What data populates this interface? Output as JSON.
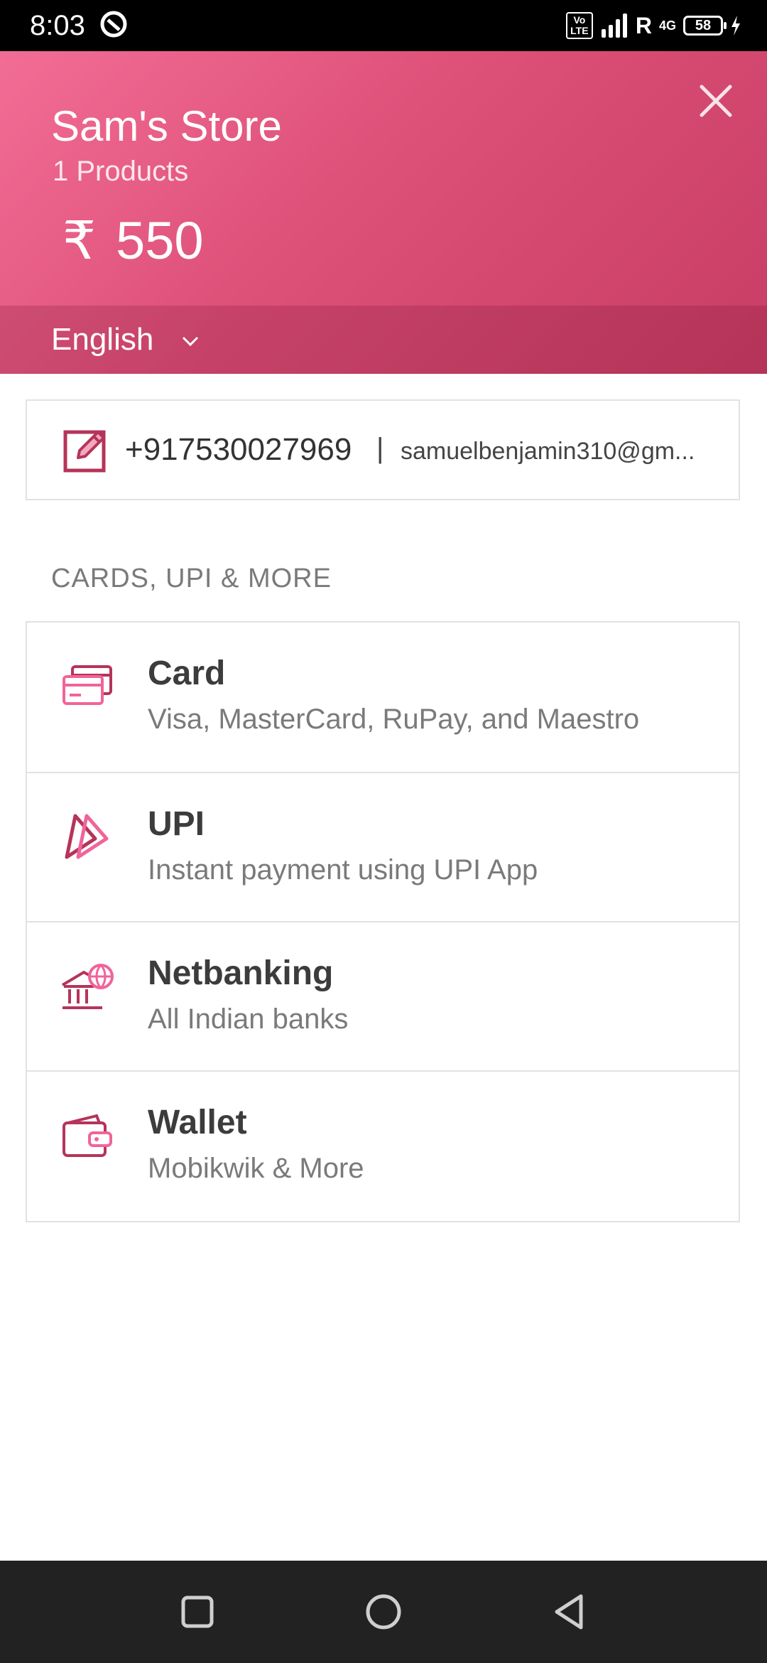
{
  "status_bar": {
    "time": "8:03",
    "volte": "Vo LTE",
    "roaming": "R",
    "network": "4G",
    "battery": "58"
  },
  "header": {
    "store_name": "Sam's Store",
    "products": "1 Products",
    "currency_symbol": "₹",
    "amount": "550",
    "language": "English",
    "accent_color": "#dd5078"
  },
  "contact": {
    "phone": "+917530027969",
    "separator": "|",
    "email": "samuelbenjamin310@gm..."
  },
  "section_title": "CARDS, UPI & MORE",
  "methods": [
    {
      "title": "Card",
      "subtitle": "Visa, MasterCard, RuPay, and Maestro",
      "icon": "card-icon"
    },
    {
      "title": "UPI",
      "subtitle": "Instant payment using UPI App",
      "icon": "upi-icon"
    },
    {
      "title": "Netbanking",
      "subtitle": "All Indian banks",
      "icon": "bank-icon"
    },
    {
      "title": "Wallet",
      "subtitle": "Mobikwik & More",
      "icon": "wallet-icon"
    }
  ],
  "nav": [
    "recents-icon",
    "home-icon",
    "back-icon"
  ]
}
